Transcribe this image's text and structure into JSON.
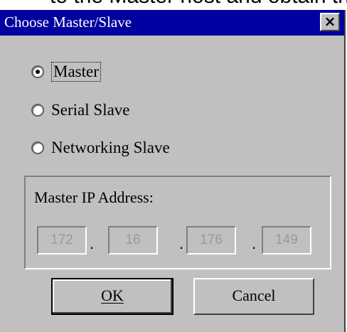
{
  "document": {
    "background_text": "to the Master host and obtain th"
  },
  "dialog": {
    "title": "Choose Master/Slave",
    "close_label": "×"
  },
  "mode_options": [
    {
      "label": "Master",
      "checked": true
    },
    {
      "label": "Serial Slave",
      "checked": false
    },
    {
      "label": "Networking Slave",
      "checked": false
    }
  ],
  "master_ip": {
    "group_label": "Master IP Address:",
    "octets": [
      "172",
      "16",
      "176",
      "149"
    ],
    "separator": "."
  },
  "buttons": {
    "ok_label": "OK",
    "cancel_label": "Cancel"
  },
  "colors": {
    "title_bar": "#0000a0",
    "dialog_face": "#c0c0c0",
    "disabled_text": "#9a9a9a"
  }
}
